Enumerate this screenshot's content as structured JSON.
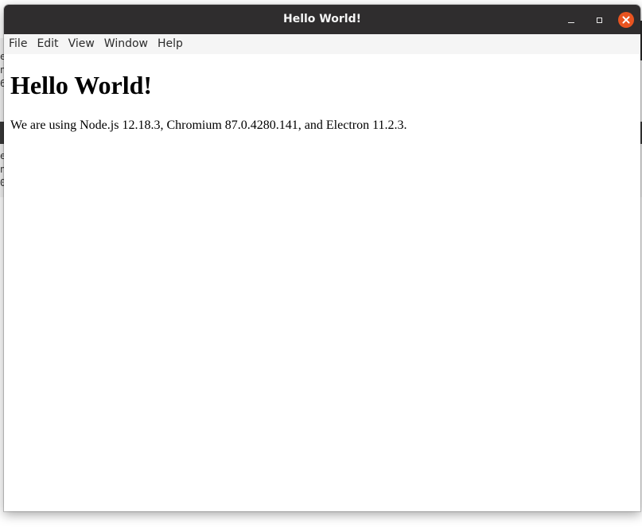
{
  "window": {
    "title": "Hello World!",
    "controls": {
      "minimize": "minimize",
      "maximize": "maximize",
      "close": "close"
    },
    "close_color": "#e95420",
    "titlebar_color": "#2f2d2e"
  },
  "menubar": {
    "items": [
      "File",
      "Edit",
      "View",
      "Window",
      "Help"
    ]
  },
  "content": {
    "heading": "Hello World!",
    "text_prefix": "We are using Node.js ",
    "node_version": "12.18.3",
    "text_mid1": ", Chromium ",
    "chromium_version": "87.0.4280.141",
    "text_mid2": ", and Electron ",
    "electron_version": "11.2.3",
    "text_suffix": "."
  },
  "background": {
    "left_edge_chars": [
      "e",
      "n",
      "6",
      "e",
      "n",
      "0"
    ]
  }
}
